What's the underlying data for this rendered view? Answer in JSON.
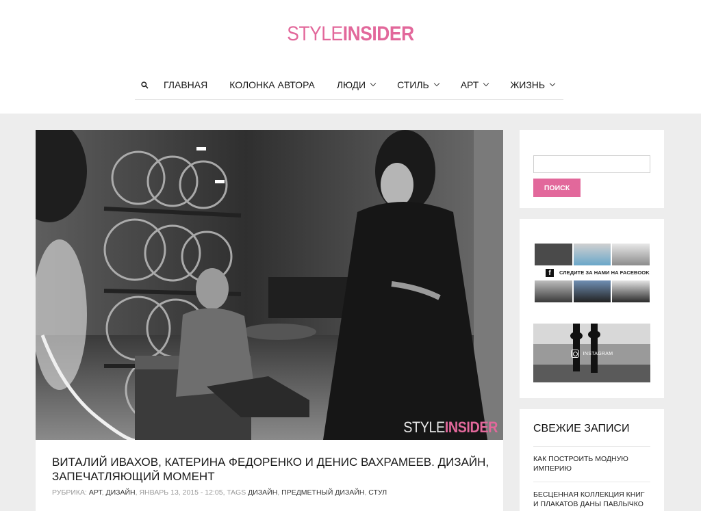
{
  "site": {
    "logo_part1": "STYLE",
    "logo_part2": "INSIDER"
  },
  "nav": {
    "search_icon": "search-icon",
    "items": [
      {
        "label": "ГЛАВНАЯ",
        "dropdown": false
      },
      {
        "label": "КОЛОНКА АВТОРА",
        "dropdown": false
      },
      {
        "label": "ЛЮДИ",
        "dropdown": true
      },
      {
        "label": "СТИЛЬ",
        "dropdown": true
      },
      {
        "label": "АРТ",
        "dropdown": true
      },
      {
        "label": "ЖИЗНЬ",
        "dropdown": true
      }
    ]
  },
  "post": {
    "watermark_part1": "STYLE",
    "watermark_part2": "INSIDER",
    "title": "Виталий Ивахов, Катерина Федоренко и Денис Вахрамеев. Дизайн, запечатляющий момент",
    "meta": {
      "category_label": "РУБРИКА:",
      "categories": [
        "АРТ",
        "ДИЗАЙН"
      ],
      "date": "ЯНВАРЬ 13, 2015 - 12:05,",
      "tags_label": "TAGS",
      "tags": [
        "ДИЗАЙН",
        "ПРЕДМЕТНЫЙ ДИЗАЙН",
        "СТУЛ"
      ]
    }
  },
  "sidebar": {
    "search": {
      "input_value": "",
      "placeholder": "",
      "button_label": "ПОИСК"
    },
    "facebook": {
      "label": "СЛЕДИТЕ ЗА НАМИ НА FACEBOOK",
      "icon_letter": "f"
    },
    "instagram": {
      "label": "INSTAGRAM"
    },
    "recent": {
      "title": "Свежие записи",
      "items": [
        "Как построить модную империю",
        "Бесценная коллекция книг и плакатов Даны Павлычко"
      ]
    }
  },
  "colors": {
    "accent": "#e2689b",
    "page_bg": "#ededed",
    "card_bg": "#ffffff",
    "text": "#1a1a1a",
    "meta_text": "#999999"
  }
}
